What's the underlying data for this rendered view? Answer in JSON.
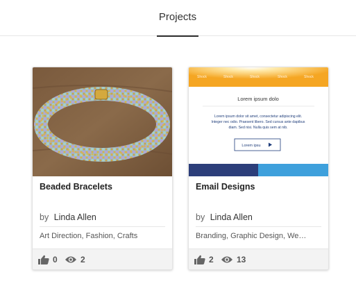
{
  "tabs": {
    "projects_label": "Projects"
  },
  "colors": {
    "accent": "#2b2b2b",
    "email_orange": "#f5a623",
    "email_blue": "#1f3d7a",
    "email_sky": "#3ea0dc"
  },
  "cards": [
    {
      "title": "Beaded Bracelets",
      "by": "by",
      "owner": "Linda Allen",
      "fields": "Art Direction, Fashion, Crafts",
      "likes": "0",
      "views": "2",
      "image_icon": "bracelet-thumbnail"
    },
    {
      "title": "Email Designs",
      "by": "by",
      "owner": "Linda Allen",
      "fields": "Branding, Graphic Design, We…",
      "likes": "2",
      "views": "13",
      "image_icon": "email-design-thumbnail",
      "thumb": {
        "nav": [
          "Shock",
          "Shock",
          "Shock",
          "Shock",
          "Shock"
        ],
        "heading": "Lorem ipsum dolo",
        "body_1": "Lorem ipsum dolor sit amet, consectetur adipiscing elit.",
        "body_2": "Integer nec odio. Praesent libero. Sed cursus ante dapibus",
        "body_3": "diam. Sed nisi. Nulla quis sem at nib.",
        "button": "Lorem ipsu"
      }
    }
  ]
}
